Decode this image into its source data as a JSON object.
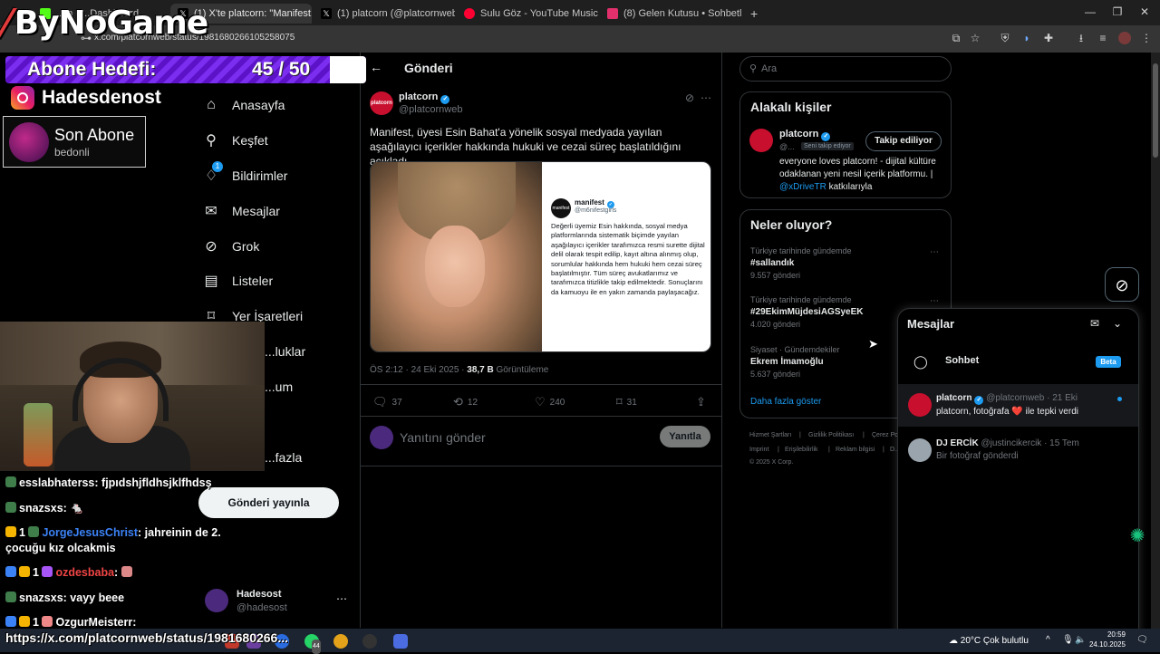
{
  "browser": {
    "tabs": [
      {
        "label": "...m - ...Dashboard",
        "color": "#53fc18"
      },
      {
        "label": "(1) X'te platcorn: \"Manifest, üye...",
        "color": "#000000",
        "active": true
      },
      {
        "label": "(1) platcorn (@platcornweb) / X",
        "color": "#000000"
      },
      {
        "label": "Sulu Göz - YouTube Music",
        "color": "#ff0033"
      },
      {
        "label": "(8) Gelen Kutusu • Sohbetler",
        "color": "#e1306c"
      }
    ],
    "new_tab": "+",
    "url": "x.com/platcornweb/status/1981680266105258075"
  },
  "overlay": {
    "logo": "ByNoGame",
    "goal_label": "Abone Hedefi:",
    "goal_count": "45 / 50",
    "goal_progress": 0.9,
    "instagram": "Hadesdenost",
    "last_sub_title": "Son Abone",
    "last_sub_name": "bedonli",
    "bottom_url": "https://x.com/platcornweb/status/1981680266..."
  },
  "chat": [
    {
      "user": "esslabhaterss",
      "msg": ": fjpıdshjfldhsjklfhdsş",
      "color": "#ffffff"
    },
    {
      "user": "snazsxs",
      "msg": ": 🐁",
      "color": "#ffffff"
    },
    {
      "user": "JorgeJesusChrist",
      "msg": ": jahreinin de 2.",
      "msg2": "çocuğu kız olcakmis",
      "color": "#3b82f6",
      "badge_num": "1"
    },
    {
      "user": "ozdesbaba",
      "msg": ": ",
      "color": "#ef4444",
      "badge_num": "1"
    },
    {
      "user": "snazsxs",
      "msg": ": vayy beee",
      "color": "#ffffff"
    },
    {
      "user": "OzgurMeisterr",
      "msg": ":",
      "color": "#ffffff",
      "badge_num": "1"
    }
  ],
  "nav": {
    "items": [
      {
        "label": "Anasayfa",
        "icon": "home-icon"
      },
      {
        "label": "Keşfet",
        "icon": "search-icon"
      },
      {
        "label": "Bildirimler",
        "icon": "bell-icon",
        "badge": "1"
      },
      {
        "label": "Mesajlar",
        "icon": "mail-icon"
      },
      {
        "label": "Grok",
        "icon": "grok-icon"
      },
      {
        "label": "Listeler",
        "icon": "list-icon"
      },
      {
        "label": "Yer İşaretleri",
        "icon": "bookmark-icon"
      },
      {
        "label": "...luklar",
        "icon": "community-icon"
      },
      {
        "label": "...um",
        "icon": "premium-icon"
      },
      {
        "label": "...fazla",
        "icon": "more-icon"
      }
    ],
    "post_button": "Gönderi yayınla",
    "account_name": "Hadesost",
    "account_handle": "@hadesost"
  },
  "post": {
    "header": "Gönderi",
    "author": "platcorn",
    "handle": "@platcornweb",
    "text": "Manifest, üyesi Esin Bahat'a yönelik sosyal medyada yayılan aşağılayıcı içerikler hakkında hukuki ve cezai süreç başlatıldığını açıkladı.",
    "embedded": {
      "name": "manifest",
      "handle": "@m6nifestgirls",
      "text": "Değerli üyemiz Esin hakkında, sosyal medya platformlarında sistematik biçimde yayılan aşağılayıcı içerikler tarafımızca resmi surette dijital delil olarak tespit edilip, kayıt altına alınmış olup, sorumlular hakkında hem hukuki hem cezai süreç başlatılmıştır. Tüm süreç avukatlarımız ve tarafımızca titizlikle takip edilmektedir. Sonuçlarını da kamuoyu ile en yakın zamanda paylaşacağız."
    },
    "time": "ÖS 2:12 · 24 Eki 2025 · ",
    "views": "38,7 B",
    "views_label": " Görüntüleme",
    "replies": "37",
    "reposts": "12",
    "likes": "240",
    "bookmarks": "31",
    "reply_placeholder": "Yanıtını gönder",
    "reply_button": "Yanıtla"
  },
  "sidebar": {
    "search_placeholder": "Ara",
    "related_title": "Alakalı kişiler",
    "related": {
      "name": "platcorn",
      "handle": "@...",
      "follows_you": "Seni takip ediyor",
      "follow_button": "Takip ediliyor",
      "bio": "everyone loves platcorn! - dijital kültüre odaklanan yeni nesil içerik platformu. | ",
      "bio_link": "@xDriveTR",
      "bio_end": " katkılarıyla"
    },
    "trends_title": "Neler oluyor?",
    "trends": [
      {
        "meta": "Türkiye tarihinde gündemde",
        "name": "#sallandık",
        "count": "9.557 gönderi"
      },
      {
        "meta": "Türkiye tarihinde gündemde",
        "name": "#29EkimMüjdesiAGSyeEK",
        "count": "4.020 gönderi"
      },
      {
        "meta": "Siyaset · Gündemdekiler",
        "name": "Ekrem İmamoğlu",
        "count": "5.637 gönderi"
      }
    ],
    "show_more": "Daha fazla göster",
    "footer": [
      "Hizmet Şartları",
      "|",
      "Gizlilik Politikası",
      "|",
      "Çerez Po...",
      "Imprint",
      "|",
      "Erişilebilirlik",
      "|",
      "Reklam bilgisi",
      "|",
      "D...",
      "© 2025 X Corp."
    ]
  },
  "messages": {
    "title": "Mesajlar",
    "chat_label": "Sohbet",
    "beta": "Beta",
    "conversations": [
      {
        "name": "platcorn",
        "handle": "@platcornweb · 21 Eki",
        "msg": "platcorn, fotoğrafa ❤️ ile tepki verdi"
      },
      {
        "name": "DJ ERCİK",
        "handle": "@justincikercik · 15 Tem",
        "msg": "Bir fotoğraf gönderdi"
      }
    ]
  },
  "taskbar": {
    "weather": "20°C  Çok bulutlu",
    "time": "20:59",
    "date": "24.10.2025",
    "whatsapp_badge": "44"
  }
}
